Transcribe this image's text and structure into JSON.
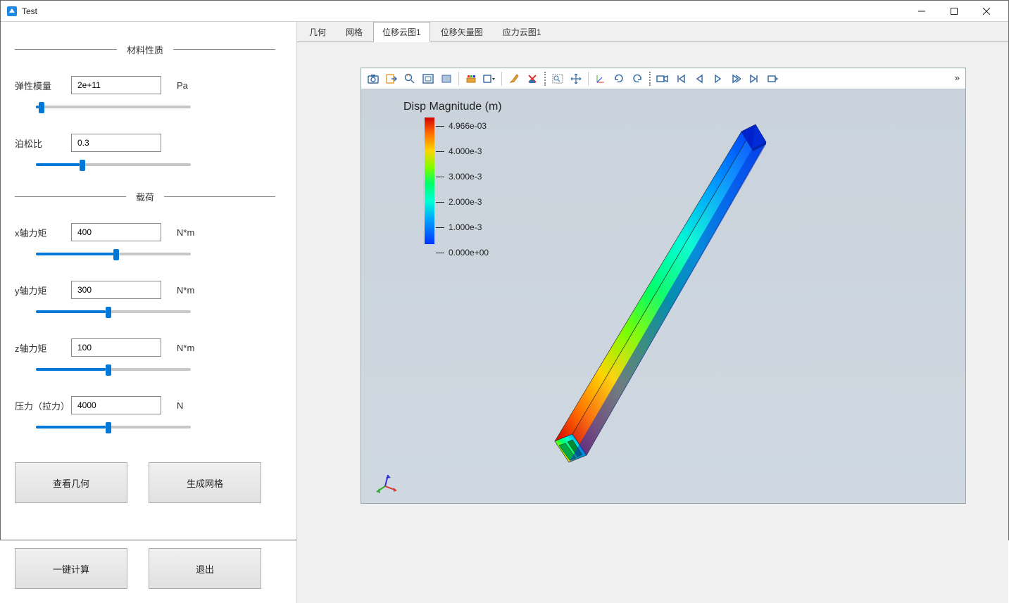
{
  "window": {
    "title": "Test"
  },
  "sidebar": {
    "group_material": "材料性质",
    "elastic_label": "弹性模量",
    "elastic_value": "2e+11",
    "elastic_unit": "Pa",
    "poisson_label": "泊松比",
    "poisson_value": "0.3",
    "group_load": "载荷",
    "mx_label": "x轴力矩",
    "mx_value": "400",
    "mx_unit": "N*m",
    "my_label": "y轴力矩",
    "my_value": "300",
    "my_unit": "N*m",
    "mz_label": "z轴力矩",
    "mz_value": "100",
    "mz_unit": "N*m",
    "pressure_label": "压力（拉力）",
    "pressure_value": "4000",
    "pressure_unit": "N",
    "sliders": {
      "elastic_pct": 2,
      "poisson_pct": 28,
      "mx_pct": 50,
      "my_pct": 45,
      "mz_pct": 45,
      "pressure_pct": 45
    },
    "btn_view_geom": "查看几何",
    "btn_gen_mesh": "生成网格",
    "btn_compute": "一键计算",
    "btn_exit": "退出"
  },
  "tabs": {
    "items": [
      "几何",
      "网格",
      "位移云图1",
      "位移矢量图",
      "应力云图1"
    ],
    "active_index": 2
  },
  "viewer": {
    "legend_title": "Disp Magnitude (m)",
    "legend_ticks": [
      "4.966e-03",
      "4.000e-3",
      "3.000e-3",
      "2.000e-3",
      "1.000e-3",
      "0.000e+00"
    ],
    "expand": "»"
  },
  "chart_data": {
    "type": "3d_contour",
    "field": "Displacement Magnitude",
    "unit": "m",
    "range": [
      0.0,
      0.004966
    ],
    "colormap": "rainbow",
    "ticks": [
      0.0,
      0.001,
      0.002,
      0.003,
      0.004,
      0.004966
    ]
  }
}
